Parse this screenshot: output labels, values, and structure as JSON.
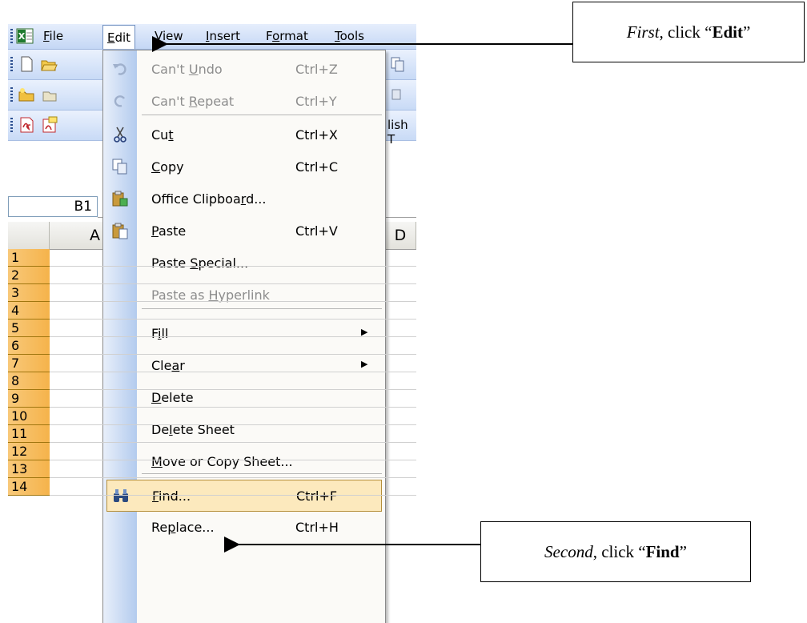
{
  "menubar": {
    "items": [
      "File",
      "Edit",
      "View",
      "Insert",
      "Format",
      "Tools"
    ]
  },
  "toolbar": {
    "row4_text": "lish T"
  },
  "namebox": {
    "value": "B1"
  },
  "columns": [
    "A",
    "D"
  ],
  "rows": [
    "1",
    "2",
    "3",
    "4",
    "5",
    "6",
    "7",
    "8",
    "9",
    "10",
    "11",
    "12",
    "13",
    "14"
  ],
  "edit_menu": {
    "items": [
      {
        "label": "Can't Undo",
        "shortcut": "Ctrl+Z",
        "icon": "undo-icon",
        "disabled": true
      },
      {
        "label": "Can't Repeat",
        "shortcut": "Ctrl+Y",
        "icon": "redo-icon",
        "disabled": true
      },
      {
        "label": "Cut",
        "shortcut": "Ctrl+X",
        "icon": "scissors-icon",
        "disabled": false
      },
      {
        "label": "Copy",
        "shortcut": "Ctrl+C",
        "icon": "copy-icon",
        "disabled": false
      },
      {
        "label": "Office Clipboard...",
        "shortcut": "",
        "icon": "clipboard-icon",
        "disabled": false
      },
      {
        "label": "Paste",
        "shortcut": "Ctrl+V",
        "icon": "paste-icon",
        "disabled": false
      },
      {
        "label": "Paste Special...",
        "shortcut": "",
        "icon": "",
        "disabled": false
      },
      {
        "label": "Paste as Hyperlink",
        "shortcut": "",
        "icon": "",
        "disabled": true
      },
      {
        "label": "Fill",
        "shortcut": "",
        "icon": "",
        "disabled": false,
        "submenu": true
      },
      {
        "label": "Clear",
        "shortcut": "",
        "icon": "",
        "disabled": false,
        "submenu": true
      },
      {
        "label": "Delete",
        "shortcut": "",
        "icon": "",
        "disabled": false
      },
      {
        "label": "Delete Sheet",
        "shortcut": "",
        "icon": "",
        "disabled": false
      },
      {
        "label": "Move or Copy Sheet...",
        "shortcut": "",
        "icon": "",
        "disabled": false
      },
      {
        "label": "Find...",
        "shortcut": "Ctrl+F",
        "icon": "binoculars-icon",
        "disabled": false,
        "highlighted": true
      },
      {
        "label": "Replace...",
        "shortcut": "Ctrl+H",
        "icon": "",
        "disabled": false
      }
    ]
  },
  "callouts": {
    "first": {
      "prefix": "First",
      "middle": ", click “",
      "bold": "Edit",
      "suffix": "”"
    },
    "second": {
      "prefix": "Second",
      "middle": ", click “",
      "bold": "Find",
      "suffix": "”"
    }
  }
}
